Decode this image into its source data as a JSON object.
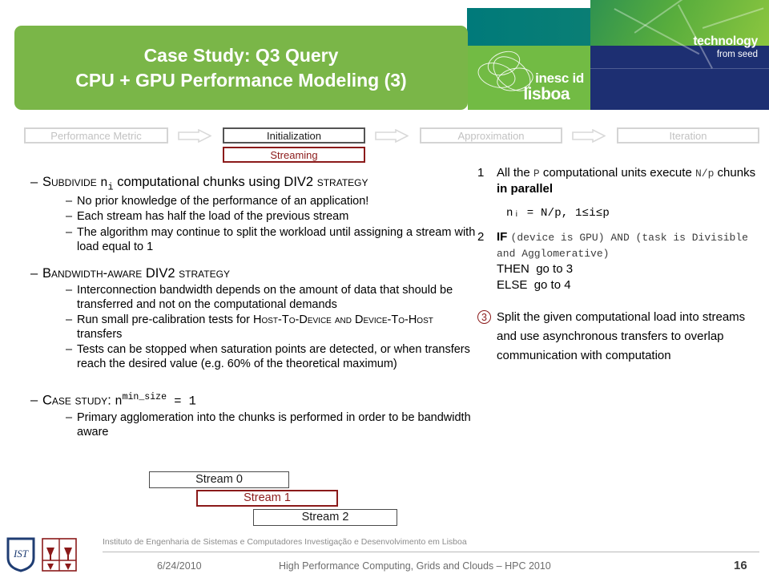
{
  "header": {
    "title_line1": "Case Study: Q3 Query",
    "title_line2": "CPU + GPU Performance Modeling (3)",
    "banner_color": "#7ab648",
    "tech_logo": {
      "line1": "technology",
      "line2": "from seed",
      "navy_color": "#1d2f72",
      "teal_color": "#007a7a"
    },
    "inesc_logo": {
      "word1": "inesc id",
      "word2": "lisboa"
    }
  },
  "process_nav": {
    "steps": [
      {
        "label": "Performance Metric",
        "state": "inactive"
      },
      {
        "label": "Initialization",
        "state": "active"
      },
      {
        "label": "Approximation",
        "state": "inactive"
      },
      {
        "label": "Iteration",
        "state": "inactive"
      }
    ],
    "substep": {
      "label": "Streaming",
      "color": "#8b1a1a"
    },
    "arrow_icon": "arrow-right-icon"
  },
  "left_column": {
    "block1": {
      "heading_pre": "S",
      "heading_caps": "ubdivide ",
      "heading_var": "n",
      "heading_var_sub": "i",
      "heading_mid": " computational chunks using ",
      "heading_strategy_pre": "DIV2 ",
      "heading_strategy_caps": "strategy",
      "bullets": [
        "No prior knowledge of the performance of an application!",
        "Each stream has half the load of the previous stream",
        "The algorithm may continue to split the workload until assigning a stream with load equal to 1"
      ]
    },
    "block2": {
      "heading_pre": "B",
      "heading_caps": "andwidth-aware ",
      "heading_tail_pre": "DIV2 ",
      "heading_tail_caps": "strategy",
      "bullets": [
        "Interconnection bandwidth depends on the amount of data that should be transferred and not on the computational demands",
        "Tests can be stopped when saturation points are detected, or when transfers reach the desired value (e.g. 60% of the theoretical maximum)"
      ],
      "bullet_hostdevice_pre": "Run small pre-calibration tests for ",
      "bullet_hostdevice_caps1": "H",
      "bullet_hostdevice_caps1b": "ost-",
      "bullet_hostdevice_caps2": "T",
      "bullet_hostdevice_caps2b": "o-",
      "bullet_hostdevice_caps3": "D",
      "bullet_hostdevice_caps3b": "evice and ",
      "bullet_hostdevice_caps4": "D",
      "bullet_hostdevice_caps4b": "evice-",
      "bullet_hostdevice_caps5": "T",
      "bullet_hostdevice_caps5b": "o-",
      "bullet_hostdevice_caps6": "H",
      "bullet_hostdevice_caps6b": "ost",
      "bullet_hostdevice_tail": " transfers"
    },
    "block3": {
      "heading_pre": "C",
      "heading_caps": "ase study",
      "heading_colon": ": ",
      "heading_var": "n",
      "heading_sup": "min_size",
      "heading_eq": " = 1",
      "bullets": [
        "Primary agglomeration into the chunks is performed in order to be bandwidth aware"
      ]
    }
  },
  "right_column": {
    "steps": [
      {
        "number": "1",
        "circled": false,
        "text_pre": "All the ",
        "code1": "P",
        "text_mid": " computational units execute ",
        "code2": "N/p",
        "text_tail": " chunks ",
        "bold_tail": "in parallel",
        "formula": "nᵢ  =  N/p,  1≤i≤p"
      },
      {
        "number": "2",
        "circled": false,
        "keyword1": "IF",
        "code_cond": "(device is GPU) AND (task is Divisible and Agglomerative)",
        "keyword2": "THEN",
        "then_target": "go to 3",
        "keyword3": "ELSE",
        "else_target": "go to 4"
      },
      {
        "number": "3",
        "circled": true,
        "text": "Split the given computational load into streams and use asynchronous transfers to overlap communication with computation"
      }
    ]
  },
  "stream_diagram": {
    "boxes": [
      {
        "label": "Stream 0",
        "style": "normal"
      },
      {
        "label": "Stream 1",
        "style": "highlight"
      },
      {
        "label": "Stream 2",
        "style": "normal"
      }
    ]
  },
  "footer": {
    "organization": "Instituto de Engenharia de Sistemas e Computadores Investigação e Desenvolvimento em Lisboa",
    "date": "6/24/2010",
    "conference": "High Performance Computing, Grids and Clouds – HPC 2010",
    "page_number": "16",
    "crest_ist": "ist-shield-icon",
    "crest_utl": "utl-crest-icon"
  }
}
